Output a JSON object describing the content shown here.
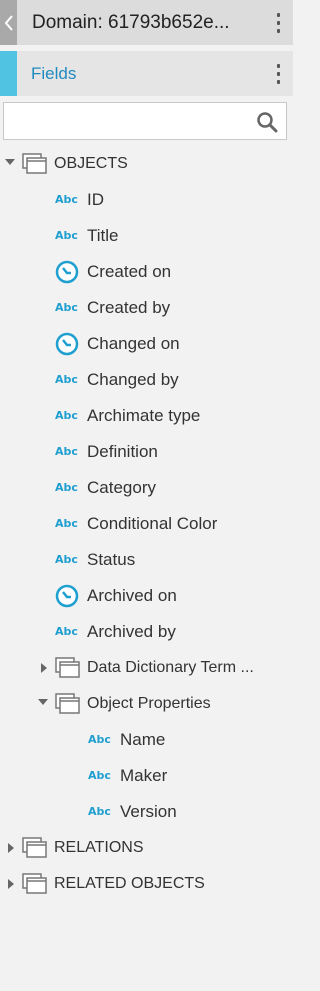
{
  "header": {
    "title": "Domain: 61793b652e...",
    "back_icon": "chevron-left-icon",
    "menu_icon": "kebab-menu-icon"
  },
  "panel": {
    "label": "Fields",
    "menu_icon": "kebab-menu-icon",
    "accent_color": "#4fc3e1"
  },
  "search": {
    "value": "",
    "placeholder": "",
    "icon": "search-icon"
  },
  "tree": {
    "objects": {
      "label": "OBJECTS",
      "expanded": true,
      "fields": [
        {
          "label": "ID",
          "type": "text"
        },
        {
          "label": "Title",
          "type": "text"
        },
        {
          "label": "Created on",
          "type": "date"
        },
        {
          "label": "Created by",
          "type": "text"
        },
        {
          "label": "Changed on",
          "type": "date"
        },
        {
          "label": "Changed by",
          "type": "text"
        },
        {
          "label": "Archimate type",
          "type": "text"
        },
        {
          "label": "Definition",
          "type": "text"
        },
        {
          "label": "Category",
          "type": "text"
        },
        {
          "label": "Conditional Color",
          "type": "text"
        },
        {
          "label": "Status",
          "type": "text"
        },
        {
          "label": "Archived on",
          "type": "date"
        },
        {
          "label": "Archived by",
          "type": "text"
        }
      ],
      "subgroups": [
        {
          "label": "Data Dictionary Term ...",
          "expanded": false,
          "fields": []
        },
        {
          "label": "Object Properties",
          "expanded": true,
          "fields": [
            {
              "label": "Name",
              "type": "text"
            },
            {
              "label": "Maker",
              "type": "text"
            },
            {
              "label": "Version",
              "type": "text"
            }
          ]
        }
      ]
    },
    "relations": {
      "label": "RELATIONS",
      "expanded": false
    },
    "related_objects": {
      "label": "RELATED OBJECTS",
      "expanded": false
    },
    "text_icon_label": "Abc"
  }
}
